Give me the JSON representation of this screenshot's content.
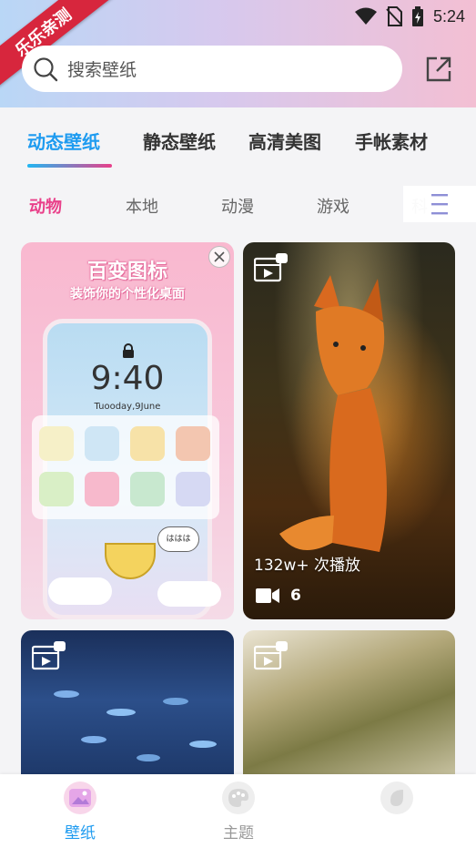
{
  "status_bar": {
    "time": "5:24"
  },
  "corner_ribbon": {
    "label": "乐乐亲测"
  },
  "search": {
    "placeholder": "搜索壁纸"
  },
  "main_tabs": [
    {
      "label": "动态壁纸",
      "active": true
    },
    {
      "label": "静态壁纸",
      "active": false
    },
    {
      "label": "高清美图",
      "active": false
    },
    {
      "label": "手帐素材",
      "active": false
    }
  ],
  "sub_tabs": [
    {
      "label": "动物",
      "active": true
    },
    {
      "label": "本地",
      "active": false
    },
    {
      "label": "动漫",
      "active": false
    },
    {
      "label": "游戏",
      "active": false
    },
    {
      "label": "科",
      "active": false
    }
  ],
  "ad_card": {
    "title": "百变图标",
    "subtitle": "装饰你的个性化桌面",
    "phone_time": "9:40",
    "phone_date": "Tuooday,9June",
    "bubble_text": "ははは"
  },
  "wallpapers": [
    {
      "plays": "132w+ 次播放",
      "video_count": "6"
    }
  ],
  "bottom_nav": [
    {
      "label": "壁纸",
      "active": true
    },
    {
      "label": "主题",
      "active": false
    },
    {
      "label": "",
      "active": false
    }
  ],
  "colors": {
    "accent": "#1e9bf0",
    "pink": "#e9408a",
    "ribbon": "#d7263d"
  }
}
